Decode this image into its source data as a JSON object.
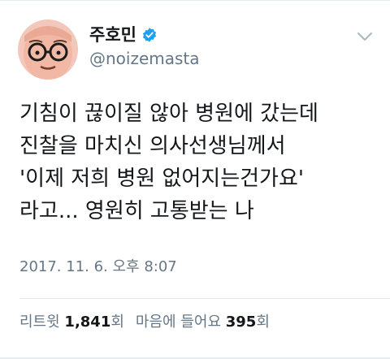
{
  "author": {
    "display_name": "주호민",
    "handle": "@noizemasta",
    "verified": true,
    "avatar_icon": "cartoon-face-avatar"
  },
  "tweet": {
    "lines": [
      "기침이 끊이질 않아 병원에 갔는데",
      "진찰을 마치신 의사선생님께서",
      "'이제 저희 병원 없어지는건가요'",
      "라고... 영원히 고통받는 나"
    ],
    "timestamp": "2017. 11. 6. 오후 8:07"
  },
  "stats": {
    "retweet_label": "리트윗",
    "retweet_count": "1,841",
    "retweet_suffix": "회",
    "like_label": "마음에 들어요",
    "like_count": "395",
    "like_suffix": "회"
  },
  "colors": {
    "verified_blue": "#1da1f2",
    "secondary_text": "#657786",
    "primary_text": "#14171a"
  }
}
